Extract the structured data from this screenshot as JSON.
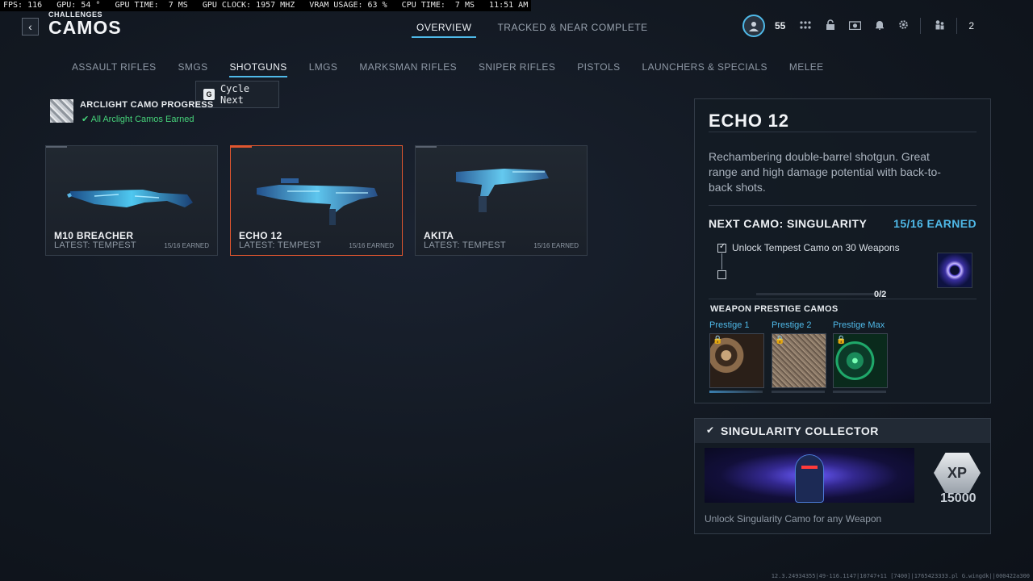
{
  "overlay": {
    "text": "FPS: 116   GPU: 54 °   GPU TIME:  7 MS   GPU CLOCK: 1957 MHZ   VRAM USAGE: 63 %   CPU TIME:  7 MS   11:51 AM"
  },
  "header": {
    "back_glyph": "‹",
    "crumb": "CHALLENGES",
    "title": "CAMOS",
    "tabs": [
      {
        "label": "OVERVIEW",
        "active": true
      },
      {
        "label": "TRACKED & NEAR COMPLETE",
        "active": false
      }
    ]
  },
  "hud": {
    "level": "55",
    "party_count": "2",
    "icons": [
      "grid-icon",
      "unlock-icon",
      "camera-icon",
      "bell-icon",
      "gear-icon",
      "party-icon"
    ]
  },
  "categories": [
    {
      "label": "ASSAULT RIFLES",
      "active": false
    },
    {
      "label": "SMGS",
      "active": false
    },
    {
      "label": "SHOTGUNS",
      "active": true
    },
    {
      "label": "LMGS",
      "active": false
    },
    {
      "label": "MARKSMAN RIFLES",
      "active": false
    },
    {
      "label": "SNIPER RIFLES",
      "active": false
    },
    {
      "label": "PISTOLS",
      "active": false
    },
    {
      "label": "LAUNCHERS & SPECIALS",
      "active": false
    },
    {
      "label": "MELEE",
      "active": false
    }
  ],
  "tooltip": {
    "key": "G",
    "label": "Cycle Next"
  },
  "arclight": {
    "title": "ARCLIGHT CAMO PROGRESS",
    "status": "All Arclight Camos Earned"
  },
  "weapons": [
    {
      "name": "M10 BREACHER",
      "latest": "LATEST: TEMPEST",
      "earned": "15/16 EARNED",
      "selected": false
    },
    {
      "name": "ECHO 12",
      "latest": "LATEST: TEMPEST",
      "earned": "15/16 EARNED",
      "selected": true
    },
    {
      "name": "AKITA",
      "latest": "LATEST: TEMPEST",
      "earned": "15/16 EARNED",
      "selected": false
    }
  ],
  "detail": {
    "title": "ECHO 12",
    "description": "Rechambering double-barrel shotgun. Great range and high damage potential with back-to-back shots.",
    "next_camo": "NEXT CAMO: SINGULARITY",
    "earned": "15/16 EARNED",
    "challenge": "Unlock Tempest Camo on 30 Weapons",
    "progress_text": "0/2",
    "progress_fraction": 0,
    "prestige_title": "WEAPON PRESTIGE CAMOS",
    "prestige": [
      {
        "label": "Prestige 1"
      },
      {
        "label": "Prestige 2"
      },
      {
        "label": "Prestige Max"
      }
    ]
  },
  "reward": {
    "title": "SINGULARITY COLLECTOR",
    "xp_label": "XP",
    "xp_amount": "15000",
    "description": "Unlock Singularity Camo for any Weapon"
  },
  "build_info": "12.3.24934355|49-116.1147|10747+11 [7400]|1765423333.pl G.wingdk||000422a300"
}
